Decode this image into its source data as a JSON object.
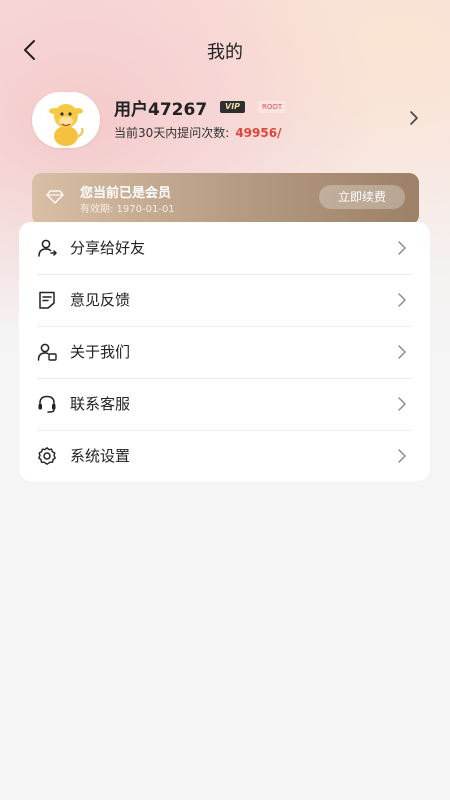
{
  "header": {
    "title": "我的"
  },
  "profile": {
    "username": "用户47267",
    "vip_badge": "VIP",
    "root_badge": "ROOT",
    "stat_label": "当前30天内提问次数:",
    "stat_value": "49956/"
  },
  "membership": {
    "title": "您当前已是会员",
    "validity": "有效期:  1970-01-01",
    "renew_label": "立即续费"
  },
  "menu": [
    {
      "label": "分享给好友",
      "icon": "share-user-icon"
    },
    {
      "label": "意见反馈",
      "icon": "feedback-icon"
    },
    {
      "label": "关于我们",
      "icon": "about-user-icon"
    },
    {
      "label": "联系客服",
      "icon": "headset-icon"
    },
    {
      "label": "系统设置",
      "icon": "gear-icon"
    }
  ],
  "colors": {
    "accent_red": "#e0453d",
    "member_gold": "#b49a80"
  }
}
